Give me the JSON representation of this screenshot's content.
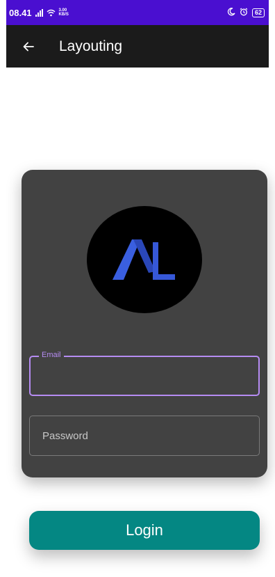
{
  "status_bar": {
    "time": "08.41",
    "net_speed_value": "3.00",
    "net_speed_unit": "KB/S",
    "battery": "62",
    "icons": [
      "signal-icon",
      "wifi-icon",
      "moon-icon",
      "alarm-icon",
      "battery-icon"
    ]
  },
  "app_bar": {
    "title": "Layouting",
    "back_icon": "arrow-back-icon"
  },
  "login_card": {
    "logo_text": "AL",
    "email_label": "Email",
    "email_value": "",
    "password_placeholder": "Password"
  },
  "login_button": {
    "label": "Login"
  },
  "colors": {
    "status_bar": "#4a0fd0",
    "app_bar": "#1b1b1b",
    "card": "#424242",
    "focus_accent": "#b68cf3",
    "logo_blue": "#3a5fe0",
    "button": "#048783"
  }
}
